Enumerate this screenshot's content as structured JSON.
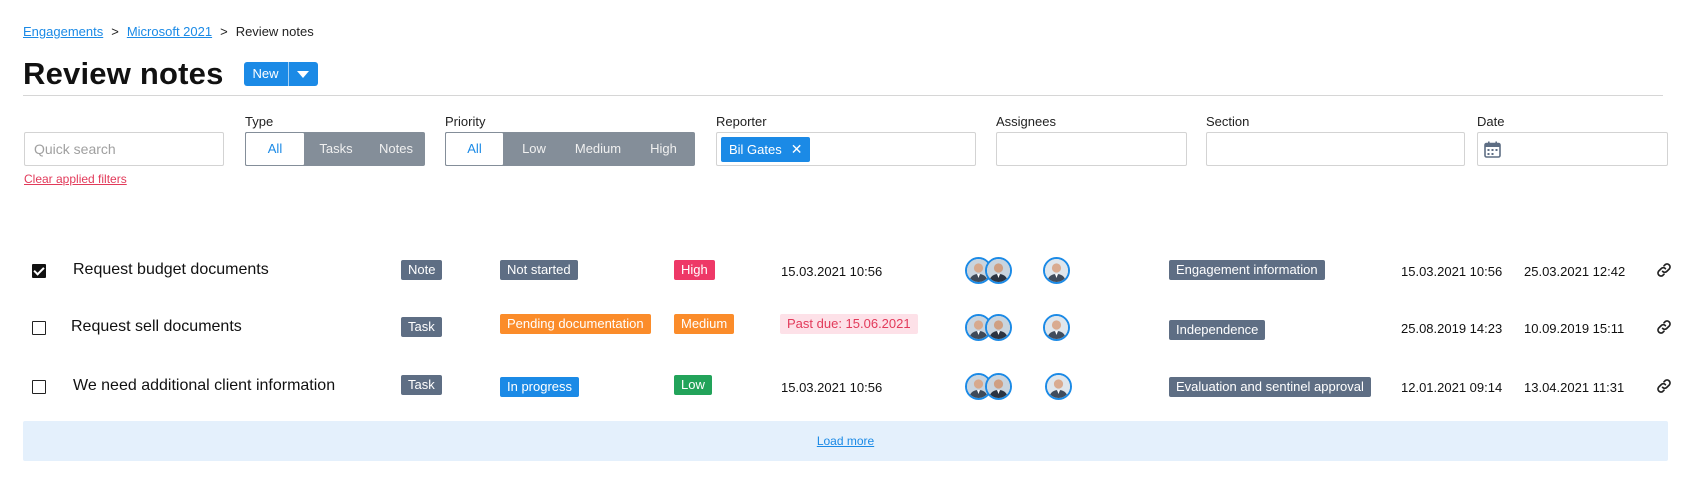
{
  "breadcrumb": {
    "items": [
      "Engagements",
      "Microsoft 2021"
    ],
    "separator": ">",
    "current": "Review notes"
  },
  "page": {
    "title": "Review notes",
    "new_button": "New"
  },
  "filters": {
    "quick_search": {
      "placeholder": "Quick search",
      "value": ""
    },
    "clear_label": "Clear applied filters",
    "type": {
      "label": "Type",
      "options": [
        "All",
        "Tasks",
        "Notes"
      ],
      "selected": "All"
    },
    "priority": {
      "label": "Priority",
      "options": [
        "All",
        "Low",
        "Medium",
        "High"
      ],
      "selected": "All"
    },
    "reporter": {
      "label": "Reporter",
      "chips": [
        "Bil Gates"
      ]
    },
    "assignees": {
      "label": "Assignees"
    },
    "section": {
      "label": "Section"
    },
    "date": {
      "label": "Date"
    }
  },
  "rows": [
    {
      "checked": true,
      "title": "Request budget documents",
      "type": "Note",
      "status": "Not started",
      "status_color": "#5e6e84",
      "priority": "High",
      "priority_color": "#ee3867",
      "due": "15.03.2021 10:56",
      "past_due": false,
      "assignee_avatars": 2,
      "reporter_avatars": 1,
      "section": "Engagement information",
      "created": "15.03.2021 10:56",
      "updated": "25.03.2021 12:42"
    },
    {
      "checked": false,
      "title": "Request sell documents",
      "type": "Task",
      "status": "Pending documentation",
      "status_color": "#fb8c2a",
      "priority": "Medium",
      "priority_color": "#fb8c2a",
      "due": "Past due: 15.06.2021",
      "past_due": true,
      "assignee_avatars": 2,
      "reporter_avatars": 1,
      "section": "Independence",
      "created": "25.08.2019 14:23",
      "updated": "10.09.2019 15:11"
    },
    {
      "checked": false,
      "title": "We need additional client information",
      "type": "Task",
      "status": "In progress",
      "status_color": "#1b8ae6",
      "priority": "Low",
      "priority_color": "#22a35a",
      "due": "15.03.2021 10:56",
      "past_due": false,
      "assignee_avatars": 2,
      "reporter_avatars": 1,
      "section": "Evaluation and sentinel approval",
      "created": "12.01.2021 09:14",
      "updated": "13.04.2021 11:31"
    }
  ],
  "load_more": "Load more",
  "colors": {
    "accent": "#1b8ae6",
    "danger": "#e23a5a",
    "neutral_badge": "#5e6e84"
  },
  "icons": [
    "chevron-down-icon",
    "close-icon",
    "calendar-icon",
    "checkbox-icon",
    "avatar",
    "link-icon"
  ]
}
